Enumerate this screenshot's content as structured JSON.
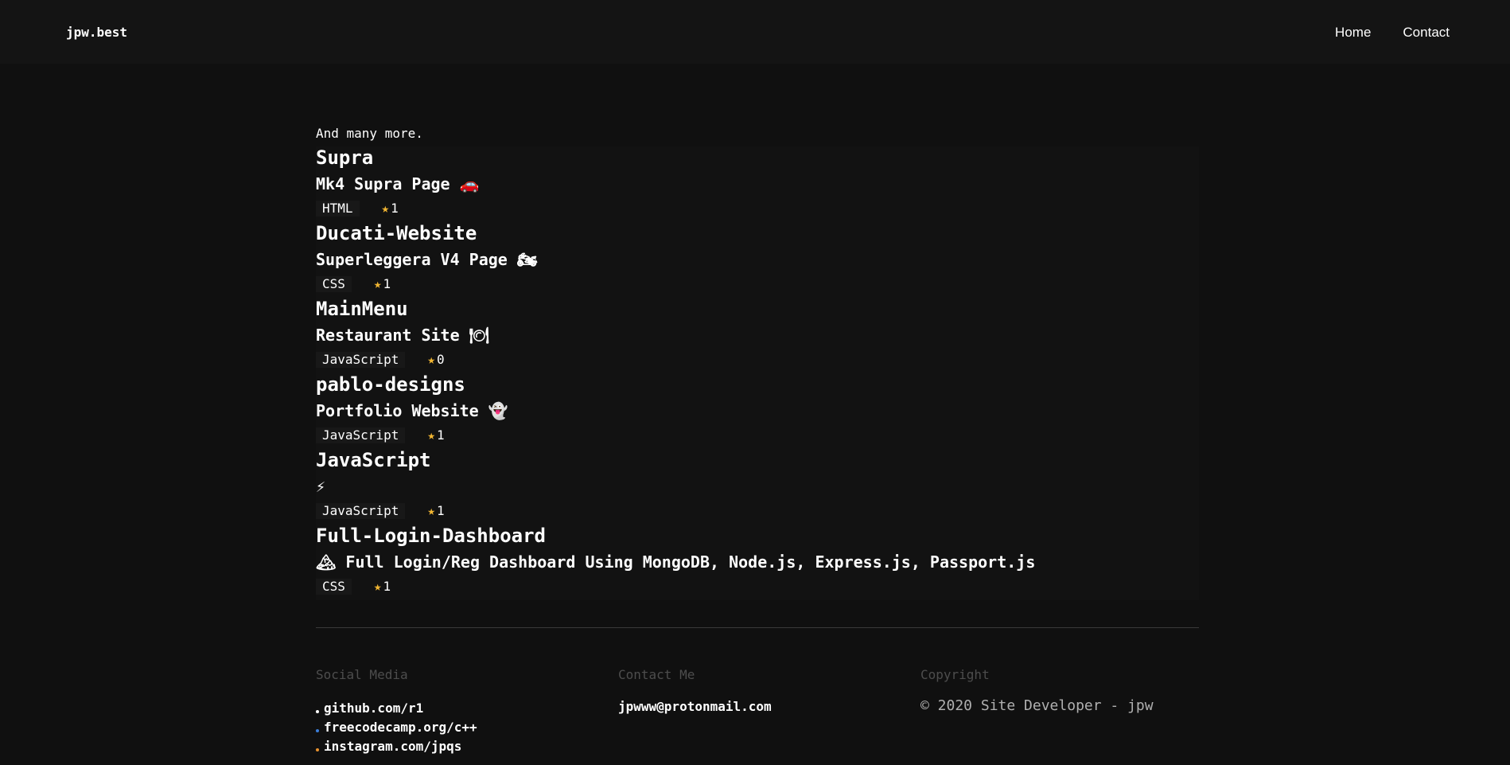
{
  "header": {
    "brand": "jpw.best",
    "nav": [
      "Home",
      "Contact"
    ]
  },
  "main": {
    "intro": "And many more.",
    "repos": [
      {
        "name": "Supra",
        "description": "Mk4 Supra Page 🚗",
        "language": "HTML",
        "stars": "1"
      },
      {
        "name": "Ducati-Website",
        "description": "Superleggera V4 Page 🏍",
        "language": "CSS",
        "stars": "1"
      },
      {
        "name": "MainMenu",
        "description": "Restaurant Site 🍽",
        "language": "JavaScript",
        "stars": "0"
      },
      {
        "name": "pablo-designs",
        "description": "Portfolio Website 👻",
        "language": "JavaScript",
        "stars": "1"
      },
      {
        "name": "JavaScript",
        "description": "⚡",
        "language": "JavaScript",
        "stars": "1"
      },
      {
        "name": "Full-Login-Dashboard",
        "description": "🏔 Full Login/Reg Dashboard Using MongoDB, Node.js, Express.js, Passport.js",
        "language": "CSS",
        "stars": "1"
      }
    ],
    "star_icon": "★"
  },
  "footer": {
    "social_heading": "Social Media",
    "social_links": [
      {
        "label": "github.com/r1",
        "dot_color": "#ffffff"
      },
      {
        "label": "freecodecamp.org/c++",
        "dot_color": "#3b7dd8"
      },
      {
        "label": "instagram.com/jpqs",
        "dot_color": "#e8922e"
      }
    ],
    "contact_heading": "Contact Me",
    "email": "jpwww@protonmail.com",
    "copyright_heading": "Copyright",
    "copyright_text": "© 2020 Site Developer - jpw"
  },
  "colors": {
    "background": "#101010",
    "header_background": "#141414",
    "star": "#f2b632",
    "muted": "#4d4d4d"
  }
}
